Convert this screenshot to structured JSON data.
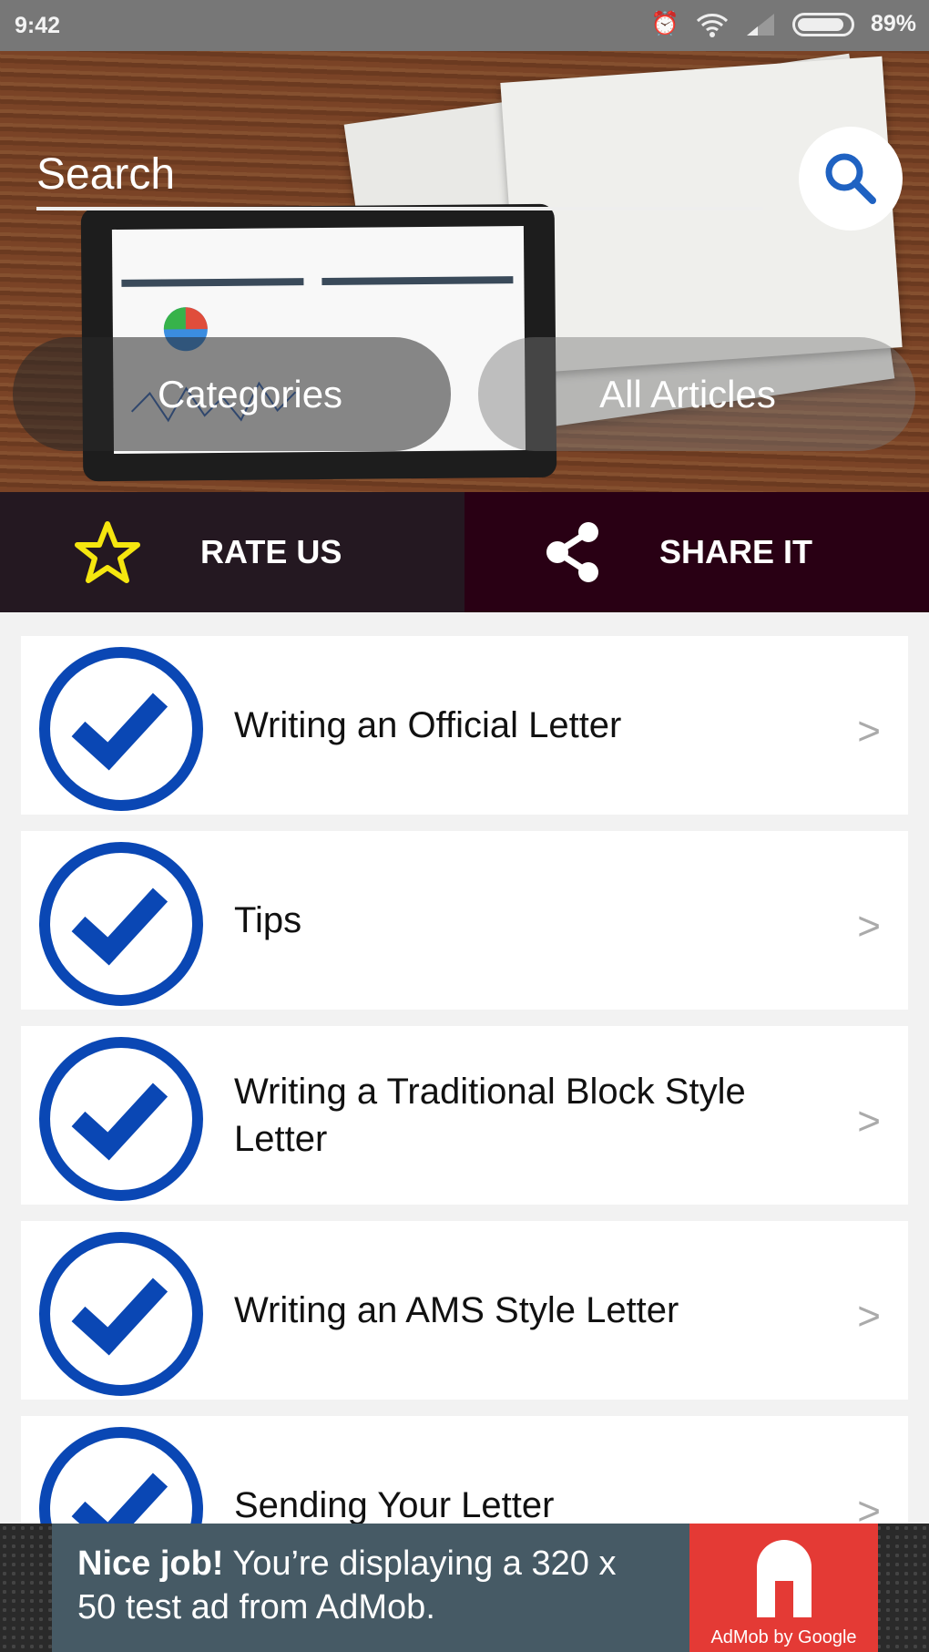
{
  "status_bar": {
    "time": "9:42",
    "battery": "89%",
    "battery_level": 0.89,
    "icons": [
      "alarm-icon",
      "wifi-icon",
      "signal-icon",
      "battery-icon"
    ]
  },
  "header": {
    "search_placeholder": "Search",
    "search_icon": "search-icon",
    "categories_label": "Categories",
    "all_articles_label": "All Articles"
  },
  "actions": {
    "rate_label": "RATE US",
    "share_label": "SHARE IT",
    "rate_color": "#f5e60f"
  },
  "articles": [
    {
      "title": "Writing an Official Letter"
    },
    {
      "title": "Tips"
    },
    {
      "title": "Writing a Traditional Block Style Letter"
    },
    {
      "title": "Writing an AMS Style Letter"
    },
    {
      "title": "Sending Your Letter"
    }
  ],
  "colors": {
    "check_blue": "#0a47b4",
    "ad_red": "#e43a35"
  },
  "ad": {
    "bold": "Nice job!",
    "text": " You’re displaying a 320 x 50 test ad from AdMob.",
    "brand": "AdMob by Google"
  }
}
